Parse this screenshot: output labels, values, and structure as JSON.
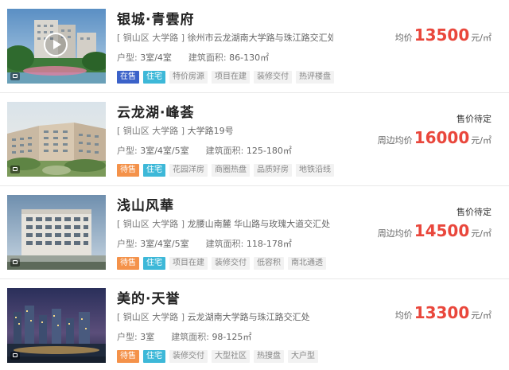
{
  "listings": [
    {
      "title": "银城·青雲府",
      "district": "[ 铜山区 大学路 ]",
      "address": "徐州市云龙湖南大学路与珠江路交汇处路...",
      "layout_label": "户型:",
      "layout_value": "3室/4室",
      "area_label": "建筑面积:",
      "area_value": "86-130㎡",
      "status_tag": "在售",
      "type_tag": "住宅",
      "tags": [
        "特价房源",
        "项目在建",
        "装修交付",
        "热评楼盘"
      ],
      "price_status": "",
      "price_label": "均价",
      "price_value": "13500",
      "price_unit": "元/㎡",
      "has_video": true
    },
    {
      "title": "云龙湖·峰荟",
      "district": "[ 铜山区 大学路 ]",
      "address": "大学路19号",
      "layout_label": "户型:",
      "layout_value": "3室/4室/5室",
      "area_label": "建筑面积:",
      "area_value": "125-180㎡",
      "status_tag": "待售",
      "type_tag": "住宅",
      "tags": [
        "花园洋房",
        "商圈热盘",
        "品质好房",
        "地铁沿线"
      ],
      "price_status": "售价待定",
      "price_label": "周边均价",
      "price_value": "16000",
      "price_unit": "元/㎡",
      "has_video": false
    },
    {
      "title": "浅山风華",
      "district": "[ 铜山区 大学路 ]",
      "address": "龙腰山南麓 华山路与玫瑰大道交汇处",
      "layout_label": "户型:",
      "layout_value": "3室/4室/5室",
      "area_label": "建筑面积:",
      "area_value": "118-178㎡",
      "status_tag": "待售",
      "type_tag": "住宅",
      "tags": [
        "项目在建",
        "装修交付",
        "低容积",
        "南北通透"
      ],
      "price_status": "售价待定",
      "price_label": "周边均价",
      "price_value": "14500",
      "price_unit": "元/㎡",
      "has_video": false
    },
    {
      "title": "美的·天誉",
      "district": "[ 铜山区 大学路 ]",
      "address": "云龙湖南大学路与珠江路交汇处",
      "layout_label": "户型:",
      "layout_value": "3室",
      "area_label": "建筑面积:",
      "area_value": "98-125㎡",
      "status_tag": "待售",
      "type_tag": "住宅",
      "tags": [
        "装修交付",
        "大型社区",
        "热搜盘",
        "大户型"
      ],
      "price_status": "",
      "price_label": "均价",
      "price_value": "13300",
      "price_unit": "元/㎡",
      "has_video": false
    }
  ],
  "colors": {
    "price": "#e9473c",
    "on_sale_tag": "#3b62c9",
    "pending_tag": "#f4924a",
    "residential_tag": "#3db8d8"
  },
  "icons": {
    "video": "play-icon",
    "album": "photo-album-icon"
  }
}
